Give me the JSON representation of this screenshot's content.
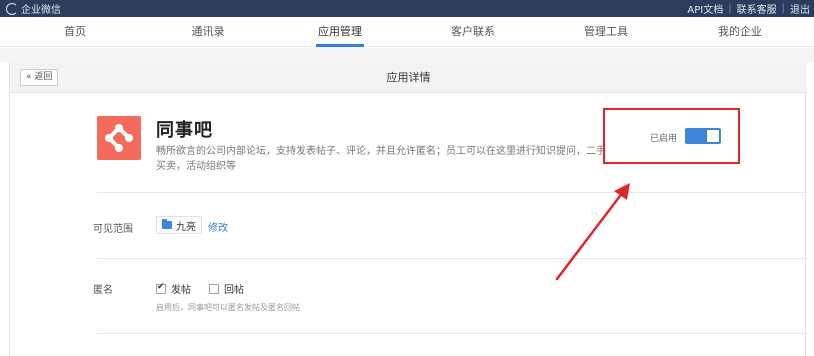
{
  "topbar": {
    "brand": "企业微信",
    "links": [
      "API文档",
      "联系客服",
      "退出"
    ]
  },
  "nav": {
    "items": [
      {
        "label": "首页"
      },
      {
        "label": "通讯录"
      },
      {
        "label": "应用管理",
        "active": true
      },
      {
        "label": "客户联系"
      },
      {
        "label": "管理工具"
      },
      {
        "label": "我的企业"
      }
    ]
  },
  "card": {
    "back_label": "« 返回",
    "title": "应用详情"
  },
  "app": {
    "name": "同事吧",
    "description": "畅所欲言的公司内部论坛，支持发表帖子、评论，并且允许匿名；员工可以在这里进行知识提问，二手买卖，活动组织等",
    "icon": "share-nodes-icon",
    "icon_color": "#f26b5b"
  },
  "status": {
    "label": "已启用",
    "enabled": true,
    "accent": "#3f85d7",
    "highlight_color": "#e0262d"
  },
  "scope": {
    "label": "可见范围",
    "value": "九亮",
    "edit_label": "修改"
  },
  "anonymous": {
    "label": "匿名",
    "options": [
      {
        "label": "发帖",
        "checked": true
      },
      {
        "label": "回帖",
        "checked": false
      }
    ],
    "hint": "启用后，同事吧可以匿名发帖及匿名回帖"
  }
}
